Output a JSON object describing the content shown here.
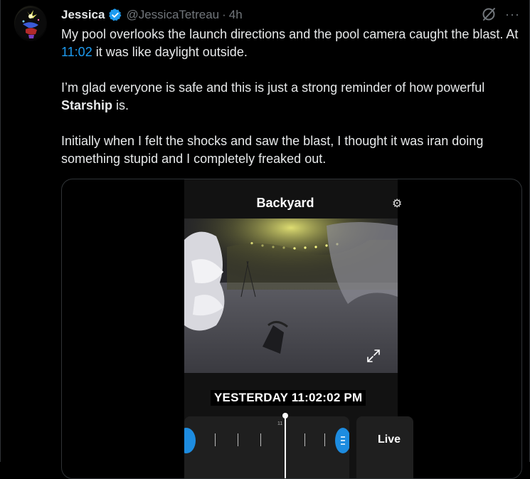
{
  "tweet": {
    "author_name": "Jessica",
    "handle": "@JessicaTetreau",
    "separator": "·",
    "time_ago": "4h",
    "more_label": "···",
    "paragraphs": {
      "p1_before": "My pool overlooks the launch directions and the pool camera caught the blast. At ",
      "p1_link": "11:02",
      "p1_after": " it was like daylight outside.",
      "p2_before": "I’m glad everyone is safe and this is just a strong reminder of how powerful ",
      "p2_bold": "Starship",
      "p2_after": " is.",
      "p3": "Initially when I felt the shocks and saw the blast, I thought it was iran doing something stupid and I completely freaked out."
    }
  },
  "media": {
    "camera_title": "Backyard",
    "timestamp": "YESTERDAY 11:02:02 PM",
    "timeline_tick_label": "11",
    "live_label": "Live"
  },
  "icons": {
    "verified": "verified-badge-icon",
    "grok": "grok-icon",
    "more": "more-icon",
    "expand": "expand-icon",
    "settings": "gear-icon"
  },
  "colors": {
    "accent": "#1d9bf0",
    "text": "#e7e9ea",
    "muted": "#71767b",
    "background": "#000000"
  }
}
